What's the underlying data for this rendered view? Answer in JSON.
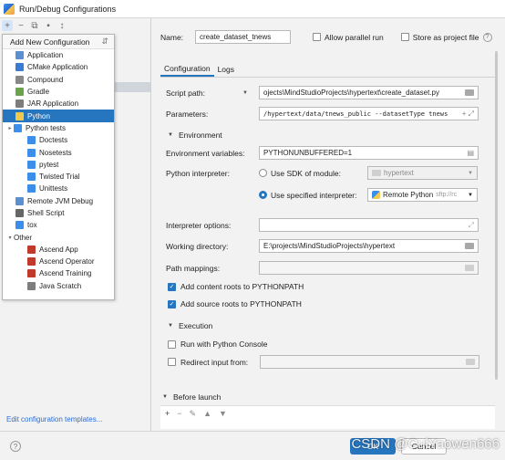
{
  "window": {
    "title": "Run/Debug Configurations"
  },
  "left": {
    "toolbar": [
      "+",
      "−",
      "⧉",
      "▪",
      "↕"
    ],
    "footer_link": "Edit configuration templates..."
  },
  "popup": {
    "header": "Add New Configuration",
    "items": [
      {
        "label": "Application",
        "indent": 1,
        "color": "#5b8fd1"
      },
      {
        "label": "CMake Application",
        "indent": 1,
        "color": "#3a7bd5"
      },
      {
        "label": "Compound",
        "indent": 1,
        "color": "#888888"
      },
      {
        "label": "Gradle",
        "indent": 1,
        "color": "#6aa34a"
      },
      {
        "label": "JAR Application",
        "indent": 1,
        "color": "#7d7d7d"
      },
      {
        "label": "Python",
        "indent": 1,
        "color": "#f2c94c",
        "selected": true
      },
      {
        "label": "Python tests",
        "indent": 0,
        "color": "#3b8eea",
        "arrow": "▸"
      },
      {
        "label": "Doctests",
        "indent": 2,
        "color": "#3b8eea"
      },
      {
        "label": "Nosetests",
        "indent": 2,
        "color": "#3b8eea"
      },
      {
        "label": "pytest",
        "indent": 2,
        "color": "#3b8eea"
      },
      {
        "label": "Twisted Trial",
        "indent": 2,
        "color": "#3b8eea"
      },
      {
        "label": "Unittests",
        "indent": 2,
        "color": "#3b8eea"
      },
      {
        "label": "Remote JVM Debug",
        "indent": 1,
        "color": "#5b8fd1"
      },
      {
        "label": "Shell Script",
        "indent": 1,
        "color": "#666666"
      },
      {
        "label": "tox",
        "indent": 1,
        "color": "#3b8eea"
      },
      {
        "label": "Other",
        "indent": 0,
        "color": "",
        "arrow": "▾"
      },
      {
        "label": "Ascend App",
        "indent": 2,
        "color": "#c0392b"
      },
      {
        "label": "Ascend Operator",
        "indent": 2,
        "color": "#c0392b"
      },
      {
        "label": "Ascend Training",
        "indent": 2,
        "color": "#c0392b"
      },
      {
        "label": "Java Scratch",
        "indent": 2,
        "color": "#7d7d7d"
      }
    ]
  },
  "config": {
    "name_label": "Name:",
    "name_value": "create_dataset_tnews",
    "allow_parallel": "Allow parallel run",
    "store_project": "Store as project file",
    "tab_configuration": "Configuration",
    "tab_logs": "Logs",
    "script_label": "Script path:",
    "script_value": "ojects\\MindStudioProjects\\hypertext\\create_dataset.py",
    "params_label": "Parameters:",
    "params_value": "/hypertext/data/tnews_public --datasetType tnews",
    "env_section": "Environment",
    "env_label": "Environment variables:",
    "env_value": "PYTHONUNBUFFERED=1",
    "interp_label": "Python interpreter:",
    "sdk_label": "Use SDK of module:",
    "sdk_value": "hypertext",
    "specified_label": "Use specified interpreter:",
    "specified_value": "Remote Python",
    "specified_sub": "sftp://rc",
    "interp_options_label": "Interpreter options:",
    "workdir_label": "Working directory:",
    "workdir_value": "E:\\projects\\MindStudioProjects\\hypertext",
    "path_map_label": "Path mappings:",
    "content_roots": "Add content roots to PYTHONPATH",
    "source_roots": "Add source roots to PYTHONPATH",
    "exec_section": "Execution",
    "run_console": "Run with Python Console",
    "redirect_label": "Redirect input from:",
    "before_launch": "Before launch"
  },
  "buttons": {
    "ok": "OK",
    "cancel": "Cancel"
  },
  "watermark": "CSDN @CuiYaowen666"
}
